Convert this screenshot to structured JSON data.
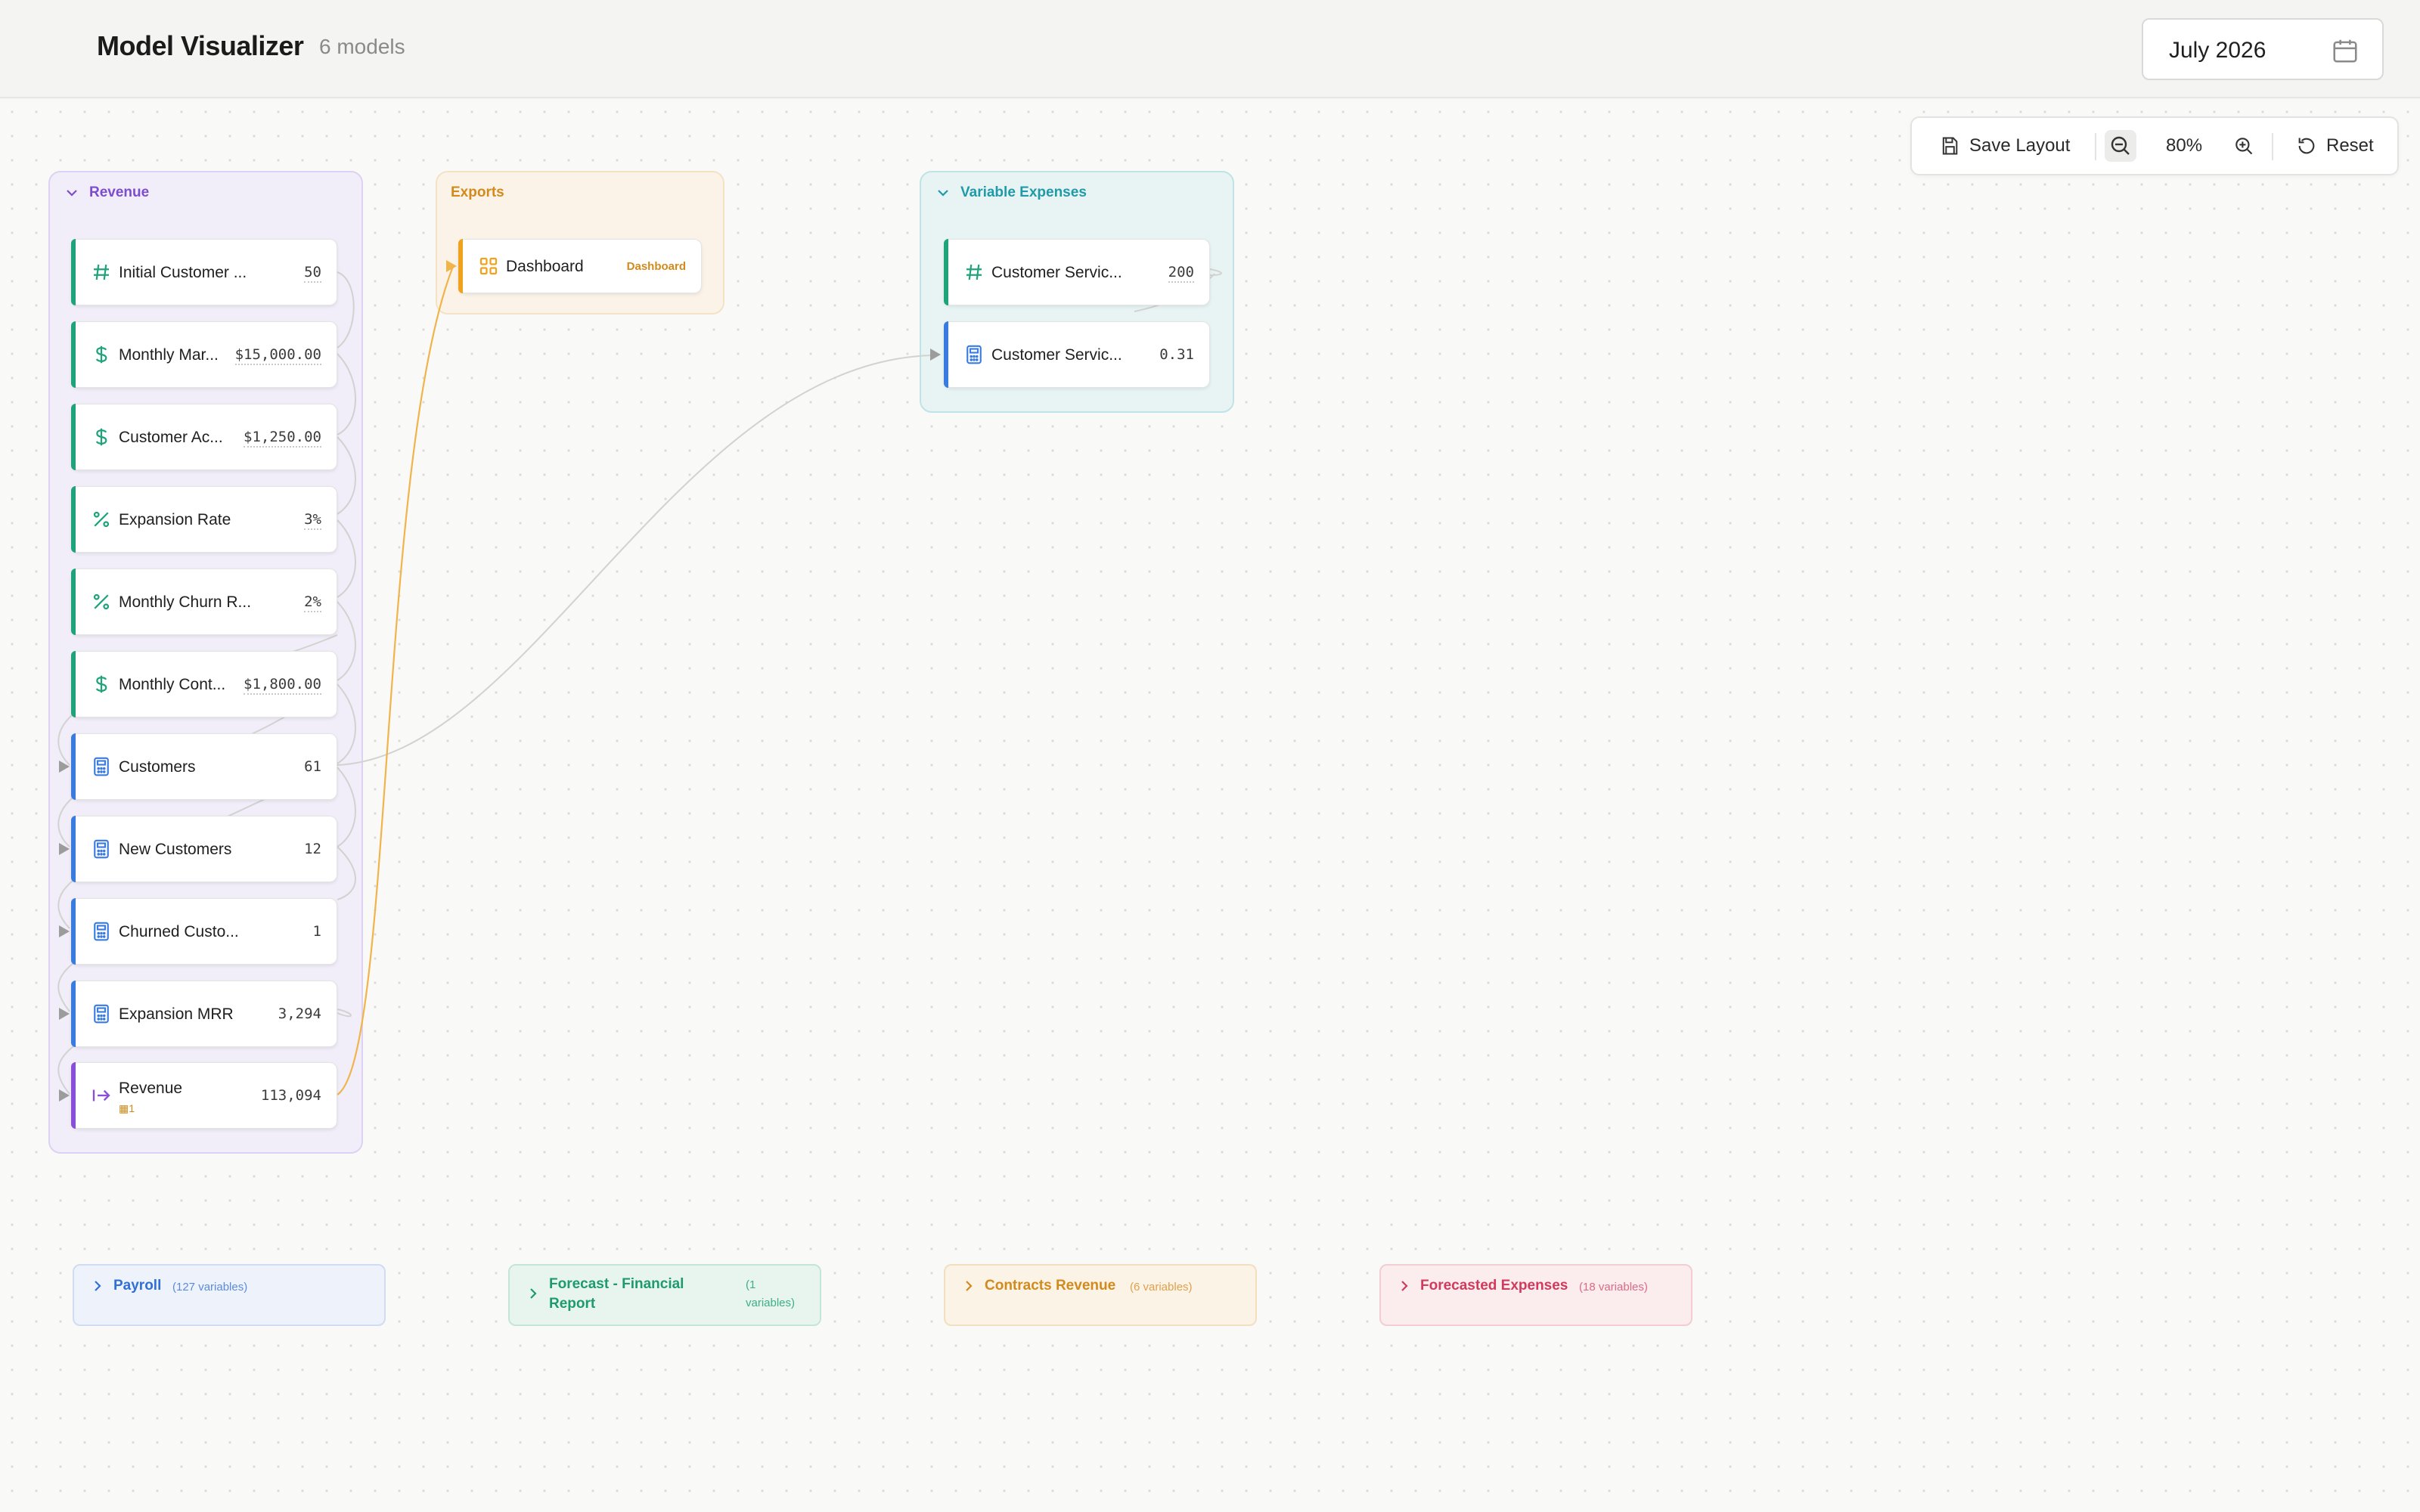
{
  "header": {
    "title": "Model Visualizer",
    "model_count": "6 models",
    "date_value": "July 2026"
  },
  "toolbar": {
    "save_label": "Save Layout",
    "zoom_level": "80%",
    "reset_label": "Reset"
  },
  "groups": {
    "revenue": {
      "title": "Revenue",
      "color": "#7c4dcc",
      "cards": [
        {
          "label": "Initial Customer ...",
          "value": "50",
          "icon": "hash-icon"
        },
        {
          "label": "Monthly Mar...",
          "value": "$15,000.00",
          "icon": "dollar-icon"
        },
        {
          "label": "Customer Ac...",
          "value": "$1,250.00",
          "icon": "dollar-icon"
        },
        {
          "label": "Expansion Rate",
          "value": "3%",
          "icon": "percent-icon"
        },
        {
          "label": "Monthly Churn R...",
          "value": "2%",
          "icon": "percent-icon"
        },
        {
          "label": "Monthly Cont...",
          "value": "$1,800.00",
          "icon": "dollar-icon"
        },
        {
          "label": "Customers",
          "value": "61",
          "icon": "calculator-icon"
        },
        {
          "label": "New Customers",
          "value": "12",
          "icon": "calculator-icon"
        },
        {
          "label": "Churned Custo...",
          "value": "1",
          "icon": "calculator-icon"
        },
        {
          "label": "Expansion MRR",
          "value": "3,294",
          "icon": "calculator-icon"
        },
        {
          "label": "Revenue",
          "value": "113,094",
          "icon": "output-arrow-icon",
          "badge": "1"
        }
      ]
    },
    "exports": {
      "title": "Exports",
      "color": "#d38a1c",
      "cards": [
        {
          "label": "Dashboard",
          "tag": "Dashboard",
          "icon": "dashboard-grid-icon"
        }
      ]
    },
    "variable_expenses": {
      "title": "Variable Expenses",
      "color": "#1f9aa8",
      "cards": [
        {
          "label": "Customer Servic...",
          "value": "200",
          "icon": "hash-icon"
        },
        {
          "label": "Customer Servic...",
          "value": "0.31",
          "icon": "calculator-icon"
        }
      ]
    }
  },
  "collapsed_groups": [
    {
      "title": "Payroll",
      "count": "(127 variables)",
      "color": "#2f6fd6"
    },
    {
      "title": "Forecast - Financial Report",
      "count": "(1 variables)",
      "color": "#1e9a6e"
    },
    {
      "title": "Contracts Revenue",
      "count": "(6 variables)",
      "color": "#d38a1c"
    },
    {
      "title": "Forecasted Expenses",
      "count": "(18 variables)",
      "color": "#d03a5c"
    }
  ],
  "colors": {
    "input_accent": "#1fa37a",
    "calc_accent": "#3a7be0",
    "output_accent": "#8a4fd8",
    "export_accent": "#f0a21f"
  }
}
